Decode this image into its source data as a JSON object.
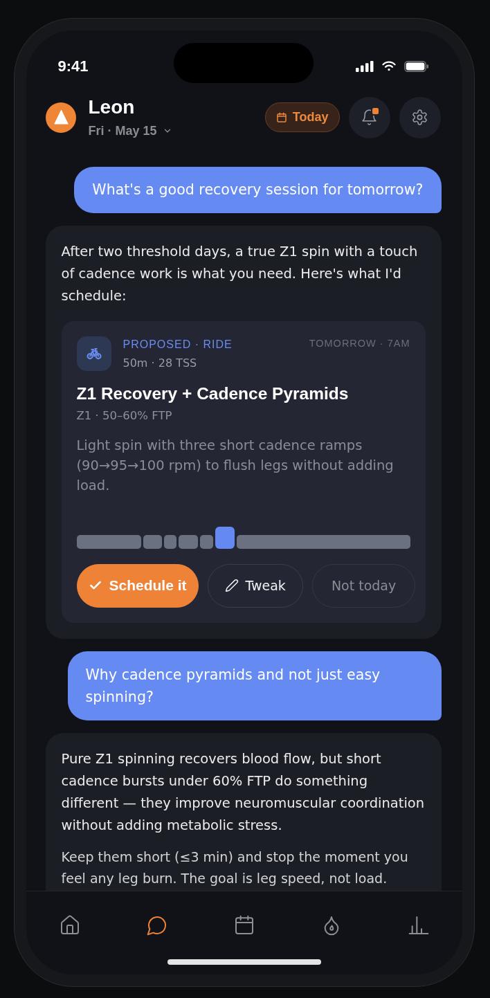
{
  "status_bar": {
    "time": "9:41"
  },
  "header": {
    "name": "Leon",
    "date": "Fri · May 15",
    "today_button": "Today",
    "unread_notifications": true
  },
  "messages": [
    {
      "kind": "user",
      "text": "What's a good recovery session for tomorrow?"
    },
    {
      "kind": "assistant",
      "paragraphs": [
        "After two threshold days, a true Z1 spin with a touch of cadence work is what you need. Here's what I'd schedule:"
      ],
      "workout": {
        "label": "PROPOSED · RIDE",
        "stats": "50m · 28 TSS",
        "when": "TOMORROW · 7AM",
        "title": "Z1 Recovery + Cadence Pyramids",
        "zone": "Z1 · 50–60% FTP",
        "description": "Light spin with three short cadence ramps (90→95→100 rpm) to flush legs without adding load.",
        "actions": [
          {
            "kind": "primary",
            "label": "Schedule it"
          },
          {
            "kind": "secondary",
            "label": "Tweak"
          },
          {
            "kind": "dismiss",
            "label": "Not today"
          }
        ]
      }
    },
    {
      "kind": "user",
      "text": "Why cadence pyramids and not just easy spinning?"
    },
    {
      "kind": "assistant",
      "paragraphs": [
        "Pure Z1 spinning recovers blood flow, but short cadence bursts under 60% FTP do something different — they improve neuromuscular coordination without adding metabolic stress.",
        "Keep them short (≤3 min) and stop the moment you feel any leg burn. The goal is leg speed, not load."
      ]
    }
  ],
  "bottom_nav": [
    {
      "kind": "home",
      "selected": false
    },
    {
      "kind": "chat",
      "selected": true
    },
    {
      "kind": "calendar",
      "selected": false
    },
    {
      "kind": "drop",
      "selected": false
    },
    {
      "kind": "stats",
      "selected": false
    }
  ]
}
